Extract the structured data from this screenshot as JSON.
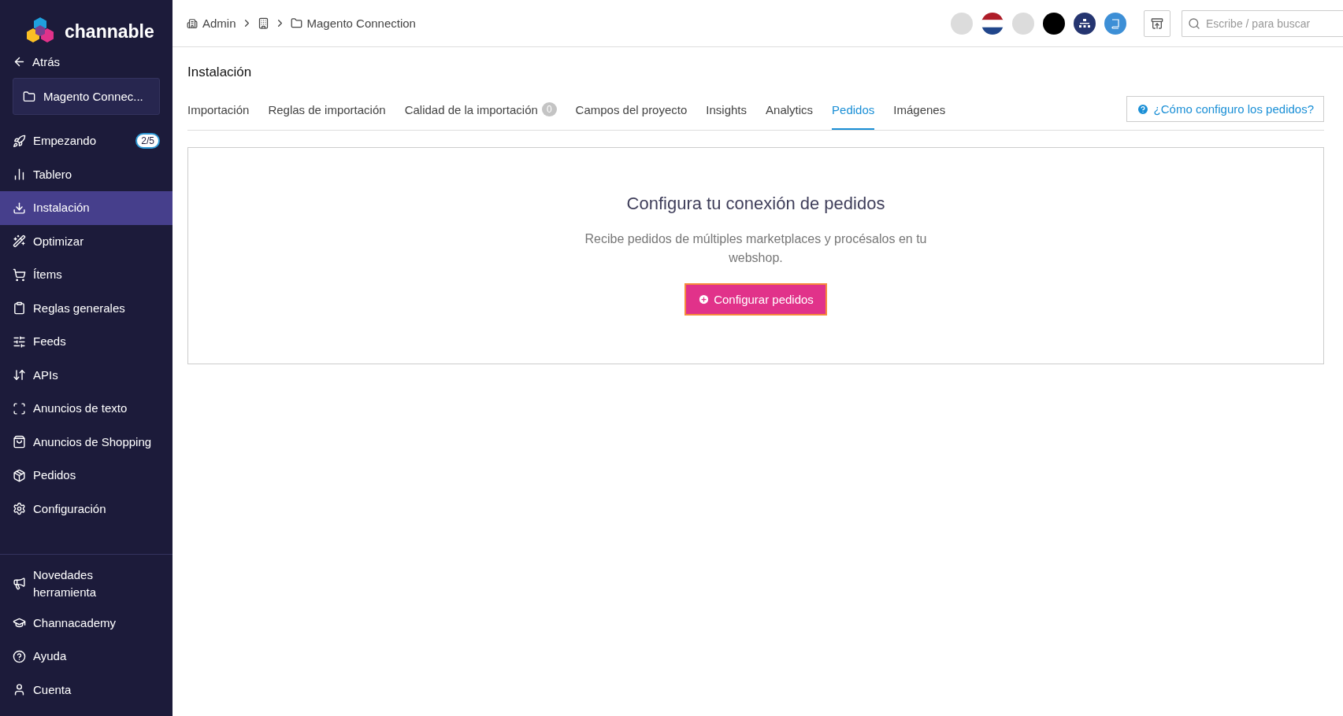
{
  "sidebar": {
    "brand": "channable",
    "back": "Atrás",
    "project": "Magento Connec...",
    "items": [
      {
        "label": "Empezando",
        "badge": "2/5",
        "selected": false
      },
      {
        "label": "Tablero",
        "selected": false
      },
      {
        "label": "Instalación",
        "selected": true
      },
      {
        "label": "Optimizar",
        "selected": false
      },
      {
        "label": "Ítems",
        "selected": false
      },
      {
        "label": "Reglas generales",
        "selected": false
      },
      {
        "label": "Feeds",
        "selected": false
      },
      {
        "label": "APIs",
        "selected": false
      },
      {
        "label": "Anuncios de texto",
        "selected": false
      },
      {
        "label": "Anuncios de Shopping",
        "selected": false
      },
      {
        "label": "Pedidos",
        "selected": false
      },
      {
        "label": "Configuración",
        "selected": false
      }
    ],
    "bottom_items": [
      {
        "label": "Novedades herramienta"
      },
      {
        "label": "Channacademy"
      },
      {
        "label": "Ayuda"
      },
      {
        "label": "Cuenta"
      }
    ]
  },
  "breadcrumb": [
    "Admin",
    "Magento Connection"
  ],
  "search": {
    "placeholder": "Escribe / para buscar"
  },
  "page_title": "Instalación",
  "tabs": [
    {
      "label": "Importación",
      "selected": false
    },
    {
      "label": "Reglas de importación",
      "selected": false
    },
    {
      "label": "Calidad de la importación",
      "badge": "0",
      "selected": false
    },
    {
      "label": "Campos del proyecto",
      "selected": false
    },
    {
      "label": "Insights",
      "selected": false
    },
    {
      "label": "Analytics",
      "selected": false
    },
    {
      "label": "Pedidos",
      "selected": true
    },
    {
      "label": "Imágenes",
      "selected": false
    }
  ],
  "help_link": "¿Cómo configuro los pedidos?",
  "card": {
    "title": "Configura tu conexión de pedidos",
    "text": "Recibe pedidos de múltiples marketplaces y procésalos en tu webshop.",
    "button": "Configurar pedidos"
  }
}
